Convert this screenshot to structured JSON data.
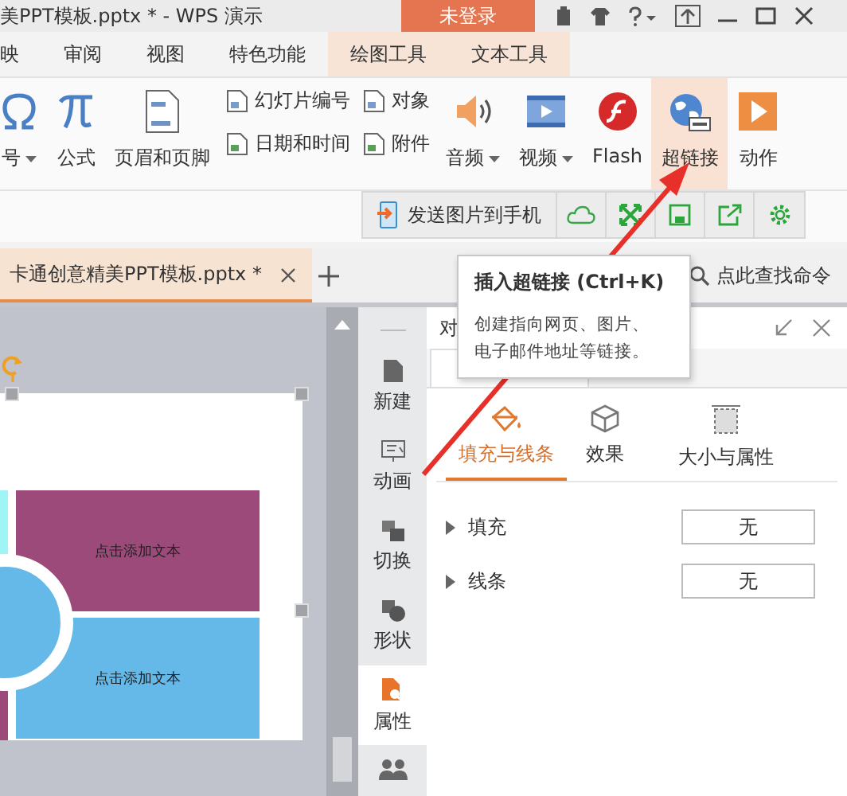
{
  "title_bar": {
    "title": "美PPT模板.pptx * - WPS 演示",
    "login_button": "未登录"
  },
  "menu_tabs": [
    {
      "label": "映",
      "contextual": false
    },
    {
      "label": "审阅",
      "contextual": false
    },
    {
      "label": "视图",
      "contextual": false
    },
    {
      "label": "特色功能",
      "contextual": false
    },
    {
      "label": "绘图工具",
      "contextual": true
    },
    {
      "label": "文本工具",
      "contextual": true
    }
  ],
  "ribbon": {
    "items": [
      {
        "kind": "omega",
        "label": "号",
        "dropdown": true,
        "hovered": false
      },
      {
        "kind": "pi",
        "label": "公式",
        "dropdown": false,
        "hovered": false
      },
      {
        "kind": "page",
        "label": "页眉和页脚",
        "dropdown": false,
        "hovered": false
      },
      {
        "kind": "small-pair",
        "items": [
          {
            "label": "幻灯片编号"
          },
          {
            "label": "日期和时间"
          }
        ]
      },
      {
        "kind": "small-pair",
        "items": [
          {
            "label": "对象"
          },
          {
            "label": "附件"
          }
        ]
      },
      {
        "kind": "audio",
        "label": "音频",
        "dropdown": true,
        "hovered": false
      },
      {
        "kind": "video",
        "label": "视频",
        "dropdown": true,
        "hovered": false
      },
      {
        "kind": "flash",
        "label": "Flash",
        "dropdown": false,
        "hovered": false
      },
      {
        "kind": "link",
        "label": "超链接",
        "dropdown": false,
        "hovered": true
      },
      {
        "kind": "action",
        "label": "动作",
        "dropdown": false,
        "hovered": false
      }
    ]
  },
  "quick_bar": {
    "send_button": "发送图片到手机"
  },
  "doc_tabs": [
    {
      "label": "卡通创意精美PPT模板.pptx *",
      "selected": true
    }
  ],
  "search": {
    "placeholder": "点此查找命令"
  },
  "tooltip": {
    "title": "插入超链接 (Ctrl+K)",
    "description": "创建指向网页、图片、电子邮件地址等链接。"
  },
  "slide": {
    "text_boxes": [
      {
        "text": "点击添加文本",
        "color": "#9b4a7a"
      },
      {
        "text": "点击添加文本",
        "color": "#65b9e9"
      }
    ]
  },
  "side_nav": [
    {
      "label": "新建",
      "selected": false
    },
    {
      "label": "动画",
      "selected": false
    },
    {
      "label": "切换",
      "selected": false
    },
    {
      "label": "形状",
      "selected": false
    },
    {
      "label": "属性",
      "selected": true
    }
  ],
  "panel": {
    "title": "对",
    "option_tabs": [
      {
        "label": "填充与线条",
        "selected": true
      },
      {
        "label": "效果",
        "selected": false
      },
      {
        "label": "大小与属性",
        "selected": false
      }
    ],
    "properties": [
      {
        "label": "填充",
        "value": "无"
      },
      {
        "label": "线条",
        "value": "无"
      }
    ]
  }
}
